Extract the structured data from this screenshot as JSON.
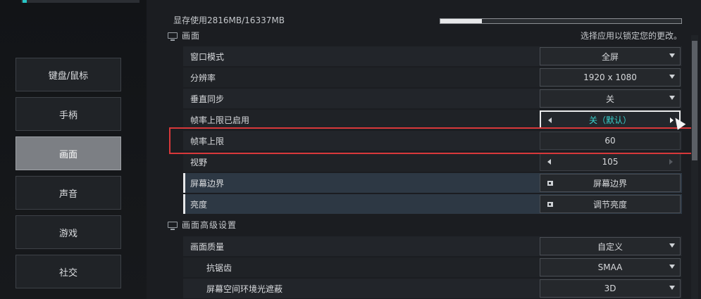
{
  "nav": {
    "items": [
      {
        "label": "键盘/鼠标",
        "active": false
      },
      {
        "label": "手柄",
        "active": false
      },
      {
        "label": "画面",
        "active": true
      },
      {
        "label": "声音",
        "active": false
      },
      {
        "label": "游戏",
        "active": false
      },
      {
        "label": "社交",
        "active": false
      }
    ]
  },
  "vram": {
    "label": "显存使用2816MB/16337MB",
    "used_mb": 2816,
    "total_mb": 16337
  },
  "sections": {
    "display": {
      "title": "画面",
      "hint": "选择应用以锁定您的更改。",
      "rows": {
        "window_mode": {
          "label": "窗口模式",
          "value": "全屏"
        },
        "resolution": {
          "label": "分辨率",
          "value": "1920 x 1080"
        },
        "vsync": {
          "label": "垂直同步",
          "value": "关"
        },
        "fps_cap_enabled": {
          "label": "帧率上限已启用",
          "value": "关（默认）"
        },
        "fps_cap": {
          "label": "帧率上限",
          "value": "60"
        },
        "fov": {
          "label": "视野",
          "value": "105"
        },
        "screen_border": {
          "label": "屏幕边界",
          "value": "屏幕边界"
        },
        "brightness": {
          "label": "亮度",
          "value": "调节亮度"
        }
      }
    },
    "advanced": {
      "title": "画面高级设置",
      "rows": {
        "quality": {
          "label": "画面质量",
          "value": "自定义"
        },
        "antialiasing": {
          "label": "抗锯齿",
          "value": "SMAA"
        },
        "ssao": {
          "label": "屏幕空间环境光遮蔽",
          "value": "3D"
        }
      }
    }
  },
  "colors": {
    "accent": "#39d3cf",
    "highlight_border": "#d8383a",
    "active_nav": "#7c7f84"
  },
  "icons": {
    "display_section": "monitor-icon",
    "advanced_section": "monitor-settings-icon",
    "dropdown": "chevron-down-icon",
    "link": "open-panel-icon"
  }
}
